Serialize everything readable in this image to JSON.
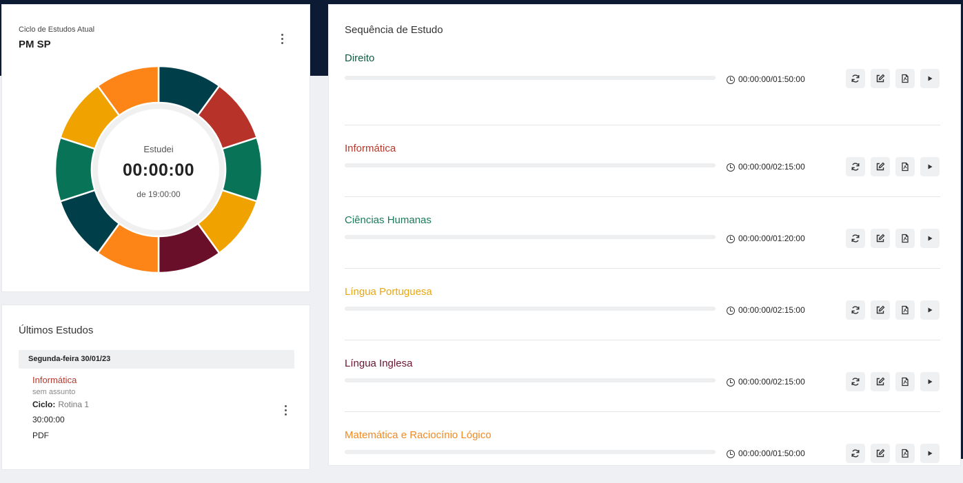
{
  "cycle": {
    "label": "Ciclo de Estudos Atual",
    "name": "PM SP",
    "studied_label": "Estudei",
    "studied_time": "00:00:00",
    "total_time": "de 19:00:00",
    "segment_colors": [
      "#003f4a",
      "#b73228",
      "#087356",
      "#f0a300",
      "#6a0f29",
      "#fd8517",
      "#003f4a",
      "#087356",
      "#f0a300",
      "#fd8517"
    ]
  },
  "recent": {
    "title": "Últimos Estudos",
    "day": "Segunda-feira 30/01/23",
    "entry": {
      "subject": "Informática",
      "topic": "sem assunto",
      "cycle_label": "Ciclo:",
      "cycle_value": "Rotina 1",
      "time": "30:00:00",
      "type": "PDF"
    }
  },
  "sequence": {
    "title": "Sequência de Estudo",
    "subjects": [
      {
        "name": "Direito",
        "color": "#0d5b40",
        "time": "00:00:00/01:50:00",
        "progress": 0
      },
      {
        "name": "Informática",
        "color": "#b23a2e",
        "time": "00:00:00/02:15:00",
        "progress": 0
      },
      {
        "name": "Ciências Humanas",
        "color": "#1a7a5a",
        "time": "00:00:00/01:20:00",
        "progress": 0
      },
      {
        "name": "Língua Portuguesa",
        "color": "#e8a611",
        "time": "00:00:00/02:15:00",
        "progress": 0
      },
      {
        "name": "Língua Inglesa",
        "color": "#6a1530",
        "time": "00:00:00/02:15:00",
        "progress": 0
      },
      {
        "name": "Matemática e Raciocínio Lógico",
        "color": "#f08a24",
        "time": "00:00:00/01:50:00",
        "progress": 0
      }
    ]
  },
  "icons": {
    "menu": "kebab-menu-icon",
    "clock": "clock-icon",
    "actions": [
      "refresh-icon",
      "edit-icon",
      "pdf-icon",
      "play-icon"
    ]
  }
}
